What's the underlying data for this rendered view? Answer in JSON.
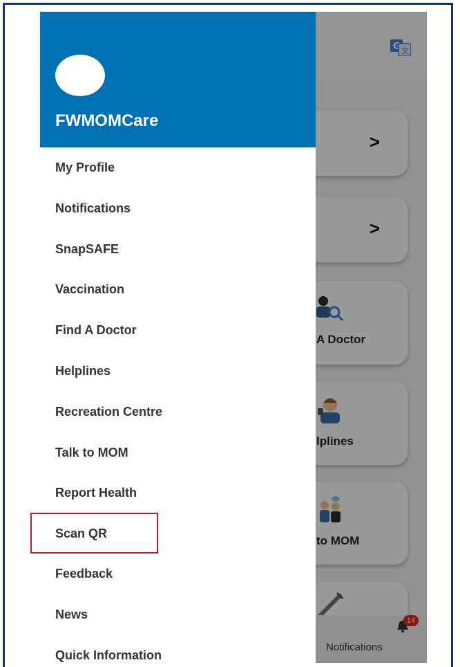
{
  "drawer": {
    "app_title": "FWMOMCare",
    "items": [
      {
        "label": "My Profile"
      },
      {
        "label": "Notifications"
      },
      {
        "label": "SnapSAFE"
      },
      {
        "label": "Vaccination"
      },
      {
        "label": "Find A Doctor"
      },
      {
        "label": "Helplines"
      },
      {
        "label": "Recreation Centre"
      },
      {
        "label": "Talk to MOM"
      },
      {
        "label": "Report Health"
      },
      {
        "label": "Scan QR"
      },
      {
        "label": "Feedback"
      },
      {
        "label": "News"
      },
      {
        "label": "Quick Information"
      }
    ]
  },
  "background": {
    "cards": [
      {
        "label": "",
        "chevron": ">"
      },
      {
        "label": "",
        "chevron": ">"
      },
      {
        "label": "A Doctor",
        "icon": "doctor-search-icon"
      },
      {
        "label": "lplines",
        "icon": "helpline-agent-icon"
      },
      {
        "label": "to MOM",
        "icon": "talk-people-icon"
      },
      {
        "label": "",
        "icon": "syringe-icon"
      }
    ],
    "bottom_nav": {
      "label": "Notifications",
      "badge": "14",
      "icon": "bell-icon"
    }
  },
  "highlight": {
    "target": "Scan QR",
    "color": "#b3202a"
  },
  "colors": {
    "header": "#0070b2",
    "frame": "#1c3553"
  }
}
